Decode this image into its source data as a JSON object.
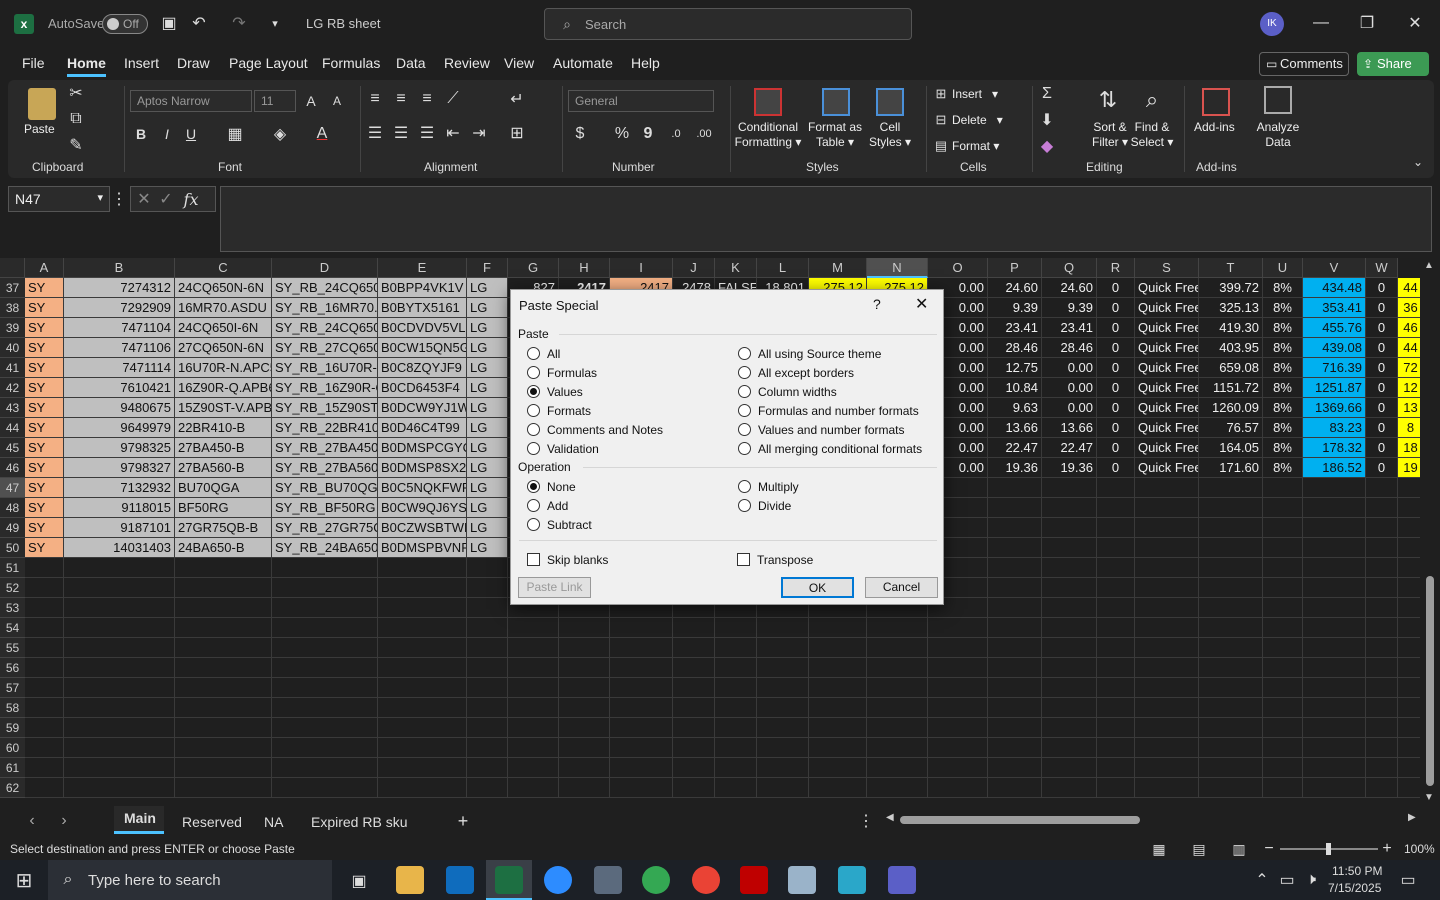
{
  "titlebar": {
    "autosave_label": "AutoSave",
    "autosave_state": "Off",
    "file_name": "LG RB sheet",
    "search_placeholder": "Search",
    "avatar_initials": "IK"
  },
  "menu": {
    "items": [
      "File",
      "Home",
      "Insert",
      "Draw",
      "Page Layout",
      "Formulas",
      "Data",
      "Review",
      "View",
      "Automate",
      "Help"
    ],
    "active": "Home",
    "comments_label": "Comments",
    "share_label": "Share"
  },
  "ribbon": {
    "clipboard": {
      "paste": "Paste",
      "label": "Clipboard"
    },
    "font": {
      "name": "Aptos Narrow",
      "size": "11",
      "label": "Font",
      "bold": "B",
      "italic": "I",
      "underline": "U"
    },
    "alignment": {
      "label": "Alignment"
    },
    "number": {
      "format": "General",
      "label": "Number",
      "currency": "$",
      "percent": "%",
      "comma": "9"
    },
    "styles": {
      "conditional": [
        "Conditional",
        "Formatting"
      ],
      "format_table": [
        "Format as",
        "Table"
      ],
      "cell_styles": [
        "Cell",
        "Styles"
      ],
      "label": "Styles"
    },
    "cells": {
      "insert": "Insert",
      "delete": "Delete",
      "format": "Format",
      "label": "Cells"
    },
    "editing": {
      "sort": [
        "Sort &",
        "Filter"
      ],
      "find": [
        "Find &",
        "Select"
      ],
      "label": "Editing"
    },
    "addins": {
      "addins": "Add-ins",
      "analyze": [
        "Analyze",
        "Data"
      ],
      "label": "Add-ins"
    }
  },
  "formula_bar": {
    "name_box": "N47",
    "fx": "fx",
    "content": ""
  },
  "columns": [
    "A",
    "B",
    "C",
    "D",
    "E",
    "F",
    "G",
    "H",
    "I",
    "J",
    "K",
    "L",
    "M",
    "N",
    "O",
    "P",
    "Q",
    "R",
    "S",
    "T",
    "U",
    "V",
    "W"
  ],
  "rows": [
    {
      "n": "37",
      "A": "SY",
      "B": "7274312",
      "C": "24CQ650N-6N",
      "D": "SY_RB_24CQ650N",
      "E": "B0BPP4VK1V",
      "F": "LG",
      "O": "0.00",
      "P": "24.60",
      "Q": "24.60",
      "R": "0",
      "S": "Quick Free",
      "T": "399.72",
      "U": "8%",
      "V": "434.48",
      "W": "0",
      "X": "44"
    },
    {
      "n": "38",
      "A": "SY",
      "B": "7292909",
      "C": "16MR70.ASDU",
      "D": "SY_RB_16MR70.AS",
      "E": "B0BYTX5161",
      "F": "LG",
      "O": "0.00",
      "P": "9.39",
      "Q": "9.39",
      "R": "0",
      "S": "Quick Free",
      "T": "325.13",
      "U": "8%",
      "V": "353.41",
      "W": "0",
      "X": "36"
    },
    {
      "n": "39",
      "A": "SY",
      "B": "7471104",
      "C": "24CQ650I-6N",
      "D": "SY_RB_24CQ650I-",
      "E": "B0CDVDV5VL",
      "F": "LG",
      "O": "0.00",
      "P": "23.41",
      "Q": "23.41",
      "R": "0",
      "S": "Quick Free",
      "T": "419.30",
      "U": "8%",
      "V": "455.76",
      "W": "0",
      "X": "46"
    },
    {
      "n": "40",
      "A": "SY",
      "B": "7471106",
      "C": "27CQ650N-6N",
      "D": "SY_RB_27CQ650N",
      "E": "B0CW15QN5G",
      "F": "LG",
      "O": "0.00",
      "P": "28.46",
      "Q": "28.46",
      "R": "0",
      "S": "Quick Free",
      "T": "403.95",
      "U": "8%",
      "V": "439.08",
      "W": "0",
      "X": "44"
    },
    {
      "n": "41",
      "A": "SY",
      "B": "7471114",
      "C": "16U70R-N.APC5",
      "D": "SY_RB_16U70R-N",
      "E": "B0C8ZQYJF9",
      "F": "LG",
      "O": "0.00",
      "P": "12.75",
      "Q": "0.00",
      "R": "0",
      "S": "Quick Free",
      "T": "659.08",
      "U": "8%",
      "V": "716.39",
      "W": "0",
      "X": "72"
    },
    {
      "n": "42",
      "A": "SY",
      "B": "7610421",
      "C": "16Z90R-Q.APB6",
      "D": "SY_RB_16Z90R-Q.",
      "E": "B0CD6453F4",
      "F": "LG",
      "O": "0.00",
      "P": "10.84",
      "Q": "0.00",
      "R": "0",
      "S": "Quick Free",
      "T": "1151.72",
      "U": "8%",
      "V": "1251.87",
      "W": "0",
      "X": "12"
    },
    {
      "n": "43",
      "A": "SY",
      "B": "9480675",
      "C": "15Z90ST-V.APB6",
      "D": "SY_RB_15Z90ST-V",
      "E": "B0DCW9YJ1W",
      "F": "LG",
      "O": "0.00",
      "P": "9.63",
      "Q": "0.00",
      "R": "0",
      "S": "Quick Free",
      "T": "1260.09",
      "U": "8%",
      "V": "1369.66",
      "W": "0",
      "X": "13"
    },
    {
      "n": "44",
      "A": "SY",
      "B": "9649979",
      "C": "22BR410-B",
      "D": "SY_RB_22BR410-B",
      "E": "B0D46C4T99",
      "F": "LG",
      "O": "0.00",
      "P": "13.66",
      "Q": "13.66",
      "R": "0",
      "S": "Quick Free",
      "T": "76.57",
      "U": "8%",
      "V": "83.23",
      "W": "0",
      "X": "8"
    },
    {
      "n": "45",
      "A": "SY",
      "B": "9798325",
      "C": "27BA450-B",
      "D": "SY_RB_27BA450-B",
      "E": "B0DMSPCGYQ",
      "F": "LG",
      "O": "0.00",
      "P": "22.47",
      "Q": "22.47",
      "R": "0",
      "S": "Quick Free",
      "T": "164.05",
      "U": "8%",
      "V": "178.32",
      "W": "0",
      "X": "18"
    },
    {
      "n": "46",
      "A": "SY",
      "B": "9798327",
      "C": "27BA560-B",
      "D": "SY_RB_27BA560-B",
      "E": "B0DMSP8SX2",
      "F": "LG",
      "O": "0.00",
      "P": "19.36",
      "Q": "19.36",
      "R": "0",
      "S": "Quick Free",
      "T": "171.60",
      "U": "8%",
      "V": "186.52",
      "W": "0",
      "X": "19"
    },
    {
      "n": "47",
      "A": "SY",
      "B": "7132932",
      "C": "BU70QGA",
      "D": "SY_RB_BU70QGA",
      "E": "B0C5NQKFWP",
      "F": "LG"
    },
    {
      "n": "48",
      "A": "SY",
      "B": "9118015",
      "C": "BF50RG",
      "D": "SY_RB_BF50RG",
      "E": "B0CW9QJ6YS",
      "F": "LG"
    },
    {
      "n": "49",
      "A": "SY",
      "B": "9187101",
      "C": "27GR75QB-B",
      "D": "SY_RB_27GR75QB",
      "E": "B0CZWSBTWR",
      "F": "LG"
    },
    {
      "n": "50",
      "A": "SY",
      "B": "14031403",
      "C": "24BA650-B",
      "D": "SY_RB_24BA650-B",
      "E": "B0DMSPBVNF",
      "F": "LG"
    },
    {
      "n": "51"
    },
    {
      "n": "52"
    },
    {
      "n": "53"
    },
    {
      "n": "54"
    },
    {
      "n": "55"
    },
    {
      "n": "56"
    },
    {
      "n": "57"
    },
    {
      "n": "58"
    },
    {
      "n": "59"
    },
    {
      "n": "60"
    },
    {
      "n": "61"
    },
    {
      "n": "62"
    }
  ],
  "row37_partial": {
    "G": "827",
    "H": "2417",
    "I": "2417",
    "J": "2478",
    "K": "FALSE",
    "L": "18.801",
    "M": "275.12",
    "N": "275.12"
  },
  "dialog": {
    "title": "Paste Special",
    "help": "?",
    "paste_label": "Paste",
    "paste_options_left": [
      "All",
      "Formulas",
      "Values",
      "Formats",
      "Comments and Notes",
      "Validation"
    ],
    "paste_options_right": [
      "All using Source theme",
      "All except borders",
      "Column widths",
      "Formulas and number formats",
      "Values and number formats",
      "All merging conditional formats"
    ],
    "paste_selected": "Values",
    "operation_label": "Operation",
    "operation_left": [
      "None",
      "Add",
      "Subtract"
    ],
    "operation_right": [
      "Multiply",
      "Divide"
    ],
    "operation_selected": "None",
    "skip_blanks": "Skip blanks",
    "transpose": "Transpose",
    "paste_link": "Paste Link",
    "ok": "OK",
    "cancel": "Cancel"
  },
  "sheets": {
    "tabs": [
      "Main",
      "Reserved",
      "NA",
      "Expired RB sku"
    ],
    "active": "Main"
  },
  "status": {
    "message": "Select destination and press ENTER or choose Paste",
    "zoom": "100%"
  },
  "taskbar": {
    "search_placeholder": "Type here to search",
    "time": "11:50 PM",
    "date": "7/15/2025"
  },
  "colors": {
    "pink": "#f4b084",
    "yellow": "#ffff00",
    "blue": "#00b0f0",
    "accent": "#4cc2ff",
    "share_green": "#3c9a54"
  }
}
